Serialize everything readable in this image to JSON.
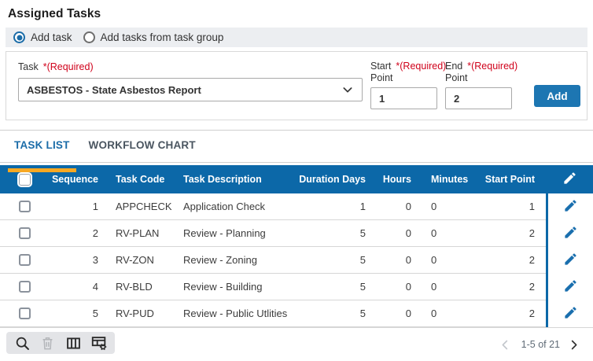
{
  "page": {
    "title": "Assigned Tasks"
  },
  "form": {
    "radios": [
      {
        "label": "Add task",
        "selected": true
      },
      {
        "label": "Add tasks from task group",
        "selected": false
      }
    ],
    "task": {
      "label": "Task",
      "required": "*(Required)",
      "value": "ASBESTOS - State Asbestos Report"
    },
    "start_point": {
      "line1": "Start",
      "line2": "Point",
      "required": "*(Required)",
      "value": "1"
    },
    "end_point": {
      "line1": "End",
      "line2": "Point",
      "required": "*(Required)",
      "value": "2"
    },
    "add_button": "Add"
  },
  "tabs": [
    {
      "label": "TASK LIST",
      "active": true
    },
    {
      "label": "WORKFLOW CHART",
      "active": false
    }
  ],
  "table": {
    "columns": [
      "Sequence",
      "Task Code",
      "Task Description",
      "Duration Days",
      "Hours",
      "Minutes",
      "Start Point"
    ],
    "rows": [
      {
        "sequence": "1",
        "task_code": "APPCHECK",
        "task_description": "Application Check",
        "duration_days": "1",
        "hours": "0",
        "minutes": "0",
        "start_point": "1"
      },
      {
        "sequence": "2",
        "task_code": "RV-PLAN",
        "task_description": "Review - Planning",
        "duration_days": "5",
        "hours": "0",
        "minutes": "0",
        "start_point": "2"
      },
      {
        "sequence": "3",
        "task_code": "RV-ZON",
        "task_description": "Review - Zoning",
        "duration_days": "5",
        "hours": "0",
        "minutes": "0",
        "start_point": "2"
      },
      {
        "sequence": "4",
        "task_code": "RV-BLD",
        "task_description": "Review - Building",
        "duration_days": "5",
        "hours": "0",
        "minutes": "0",
        "start_point": "2"
      },
      {
        "sequence": "5",
        "task_code": "RV-PUD",
        "task_description": "Review - Public Utlities",
        "duration_days": "5",
        "hours": "0",
        "minutes": "0",
        "start_point": "2"
      }
    ]
  },
  "footer": {
    "icons": [
      "search",
      "delete",
      "columns",
      "grid-settings"
    ],
    "pagination": "1-5 of 21"
  },
  "colors": {
    "header_blue": "#0c68a8",
    "accent_orange": "#f7a823",
    "button_blue": "#1d76b2",
    "link_blue": "#1a6fae",
    "required_red": "#d0021b"
  }
}
